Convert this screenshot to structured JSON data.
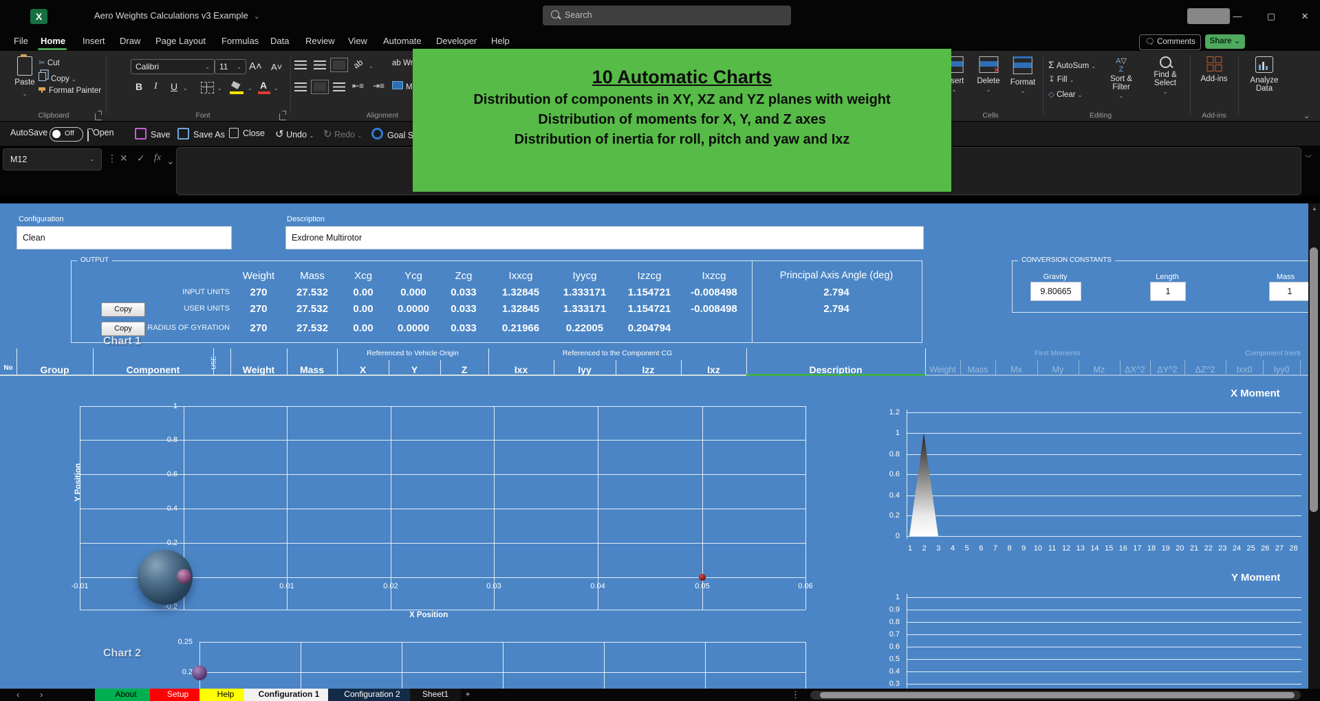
{
  "app": {
    "title": "Aero Weights Calculations v3 Example"
  },
  "titlebar": {
    "search_placeholder": "Search",
    "comments_label": "Comments",
    "share_label": "Share"
  },
  "menu": {
    "active": "Home",
    "items": [
      "File",
      "Home",
      "Insert",
      "Draw",
      "Page Layout",
      "Formulas",
      "Data",
      "Review",
      "View",
      "Automate",
      "Developer",
      "Help"
    ]
  },
  "quickbar": {
    "autosave_label": "AutoSave",
    "autosave_state": "Off",
    "open_label": "Open",
    "save_label": "Save",
    "save_as_label": "Save As",
    "close_label": "Close",
    "undo_label": "Undo",
    "redo_label": "Redo",
    "goal_label": "Goal S"
  },
  "ribbon": {
    "clipboard": {
      "group_label": "Clipboard",
      "paste": "Paste",
      "cut": "Cut",
      "copy": "Copy",
      "format_painter": "Format Painter"
    },
    "font": {
      "group_label": "Font",
      "family": "Calibri",
      "size": "11",
      "bold": "B",
      "italic": "I",
      "underline": "U"
    },
    "alignment": {
      "group_label": "Alignment",
      "wrap": "Wrap",
      "merge": "Merge"
    },
    "cells": {
      "group_label": "Cells",
      "insert": "Insert",
      "delete": "Delete",
      "format": "Format"
    },
    "editing": {
      "group_label": "Editing",
      "autosum": "AutoSum",
      "fill": "Fill",
      "clear": "Clear",
      "sort": "Sort & Filter",
      "find": "Find & Select"
    },
    "addins": {
      "group_label": "Add-ins",
      "addins_label": "Add-ins",
      "analyze_label": "Analyze Data"
    }
  },
  "formula_bar": {
    "name_box": "M12",
    "fx_label": "fx"
  },
  "banner": {
    "title": "10 Automatic Charts",
    "lines": [
      "Distribution of components in XY, XZ and YZ planes with weight",
      "Distribution of moments for X, Y, and Z axes",
      "Distribution of inertia for roll, pitch and yaw and Ixz"
    ],
    "bg_color": "#57bb47"
  },
  "config": {
    "label": "Configuration",
    "value": "Clean"
  },
  "description": {
    "label": "Description",
    "value": "Exdrone Multirotor"
  },
  "output": {
    "box_label": "OUTPUT",
    "columns": [
      "Weight",
      "Mass",
      "Xcg",
      "Ycg",
      "Zcg",
      "Ixxcg",
      "Iyycg",
      "Izzcg",
      "Ixzcg"
    ],
    "paa_header": "Principal Axis Angle (deg)",
    "copy_label": "Copy",
    "rows": [
      {
        "label": "INPUT UNITS",
        "copy": false,
        "values": [
          "270",
          "27.532",
          "0.00",
          "0.000",
          "0.033",
          "1.32845",
          "1.333171",
          "1.154721",
          "-0.008498"
        ],
        "paa": "2.794"
      },
      {
        "label": "USER UNITS",
        "copy": true,
        "values": [
          "270",
          "27.532",
          "0.00",
          "0.0000",
          "0.033",
          "1.32845",
          "1.333171",
          "1.154721",
          "-0.008498"
        ],
        "paa": "2.794"
      },
      {
        "label": "RADIUS OF GYRATION",
        "copy": true,
        "values": [
          "270",
          "27.532",
          "0.00",
          "0.0000",
          "0.033",
          "0.21966",
          "0.22005",
          "0.204794",
          ""
        ],
        "paa": ""
      }
    ]
  },
  "constants": {
    "box_label": "CONVERSION CONSTANTS",
    "fields": [
      {
        "label": "Gravity",
        "value": "9.80665"
      },
      {
        "label": "Length",
        "value": "1"
      },
      {
        "label": "Mass",
        "value": "1"
      }
    ]
  },
  "table": {
    "span_headers": [
      {
        "label": "Referenced to Vehicle Origin",
        "faded": false
      },
      {
        "label": "Referenced to the Component CG",
        "faded": false
      },
      {
        "label": "First Moments",
        "faded": true
      },
      {
        "label": "Component Inerti",
        "faded": true
      }
    ],
    "columns": [
      "No",
      "Group",
      "Component",
      "USE",
      "Weight",
      "Mass",
      "X",
      "Y",
      "Z",
      "Ixx",
      "Iyy",
      "Izz",
      "Ixz",
      "Description"
    ],
    "faded_columns": [
      "Weight",
      "Mass",
      "Mx",
      "My",
      "Mz",
      "ΔX^2",
      "ΔY^2",
      "ΔZ^2",
      "Ixx0",
      "Iyy0"
    ]
  },
  "chart_data": [
    {
      "type": "scatter",
      "variant": "bubble",
      "title": "Chart 1",
      "xlabel": "X Position",
      "ylabel": "Y Position",
      "xlim": [
        -0.01,
        0.06
      ],
      "ylim": [
        -0.2,
        1
      ],
      "grid": true,
      "x_ticks": [
        "-0.01",
        "0",
        "0.01",
        "0.02",
        "0.03",
        "0.04",
        "0.05",
        "0.06"
      ],
      "y_ticks": [
        "1",
        "0.8",
        "0.6",
        "0.4",
        "0.2",
        "0",
        "-0.2"
      ],
      "points": [
        {
          "x": 0,
          "y": 0,
          "size": "large",
          "color": "#2f4f6e",
          "note": "large CG bubble"
        },
        {
          "x": 0,
          "y": 0,
          "size": "small",
          "color": "#7d4470",
          "note": "small purple bubble"
        },
        {
          "x": 0.05,
          "y": 0,
          "size": "tiny",
          "color": "#8a1515",
          "note": "small red point"
        }
      ]
    },
    {
      "type": "area",
      "title": "X Moment",
      "ylim": [
        0,
        1.2
      ],
      "grid": true,
      "y_ticks": [
        "1.2",
        "1",
        "0.8",
        "0.6",
        "0.4",
        "0.2",
        "0"
      ],
      "x": [
        1,
        2,
        3,
        4,
        5,
        6,
        7,
        8,
        9,
        10,
        11,
        12,
        13,
        14,
        15,
        16,
        17,
        18,
        19,
        20,
        21,
        22,
        23,
        24,
        25,
        26,
        27,
        28
      ],
      "values": [
        0,
        1,
        0,
        0,
        0,
        0,
        0,
        0,
        0,
        0,
        0,
        0,
        0,
        0,
        0,
        0,
        0,
        0,
        0,
        0,
        0,
        0,
        0,
        0,
        0,
        0,
        0,
        0
      ]
    },
    {
      "type": "area",
      "title": "Y Moment",
      "grid": true,
      "y_ticks": [
        "1",
        "0.9",
        "0.8",
        "0.7",
        "0.6",
        "0.5",
        "0.4",
        "0.3"
      ],
      "note": "chart cropped at bottom of window; no series visible"
    },
    {
      "type": "scatter",
      "variant": "bubble",
      "title": "Chart 2",
      "grid": true,
      "y_ticks": [
        "0.25",
        "0.2"
      ],
      "points": [
        {
          "x": 0,
          "y": 0.2,
          "size": "small",
          "color": "#5b3a66",
          "note": "purple bubble"
        }
      ]
    }
  ],
  "tabs": {
    "items": [
      {
        "label": "About",
        "bg": "#00b050",
        "fg": "#000000",
        "active": false
      },
      {
        "label": "Setup",
        "bg": "#ff0000",
        "fg": "#ffffff",
        "active": false
      },
      {
        "label": "Help",
        "bg": "#ffff00",
        "fg": "#000000",
        "active": false
      },
      {
        "label": "Configuration 1",
        "bg": "#f2f2f2",
        "fg": "#111111",
        "active": true
      },
      {
        "label": "Configuration 2",
        "bg": "#142b47",
        "fg": "#ffffff",
        "active": false
      },
      {
        "label": "Sheet1",
        "bg": "#121212",
        "fg": "#eeeeee",
        "active": false
      }
    ],
    "add_label": "+"
  },
  "colors": {
    "sheet_blue": "#4b85c5",
    "banner_green": "#57bb47",
    "home_underline": "#4ca456",
    "active_tab_underline": "#2e9e44"
  },
  "icons": {
    "search-icon": "magnifier",
    "excel-logo": "X",
    "chevron-down-icon": "⌄",
    "undo-icon": "↺",
    "redo-icon": "↻",
    "sigma-icon": "Σ",
    "kebab-icon": "⋮",
    "close-icon": "✕",
    "minimize-icon": "—",
    "maximize-icon": "▢",
    "scissors-icon": "✂",
    "ellipsis-icon": "⋮"
  }
}
